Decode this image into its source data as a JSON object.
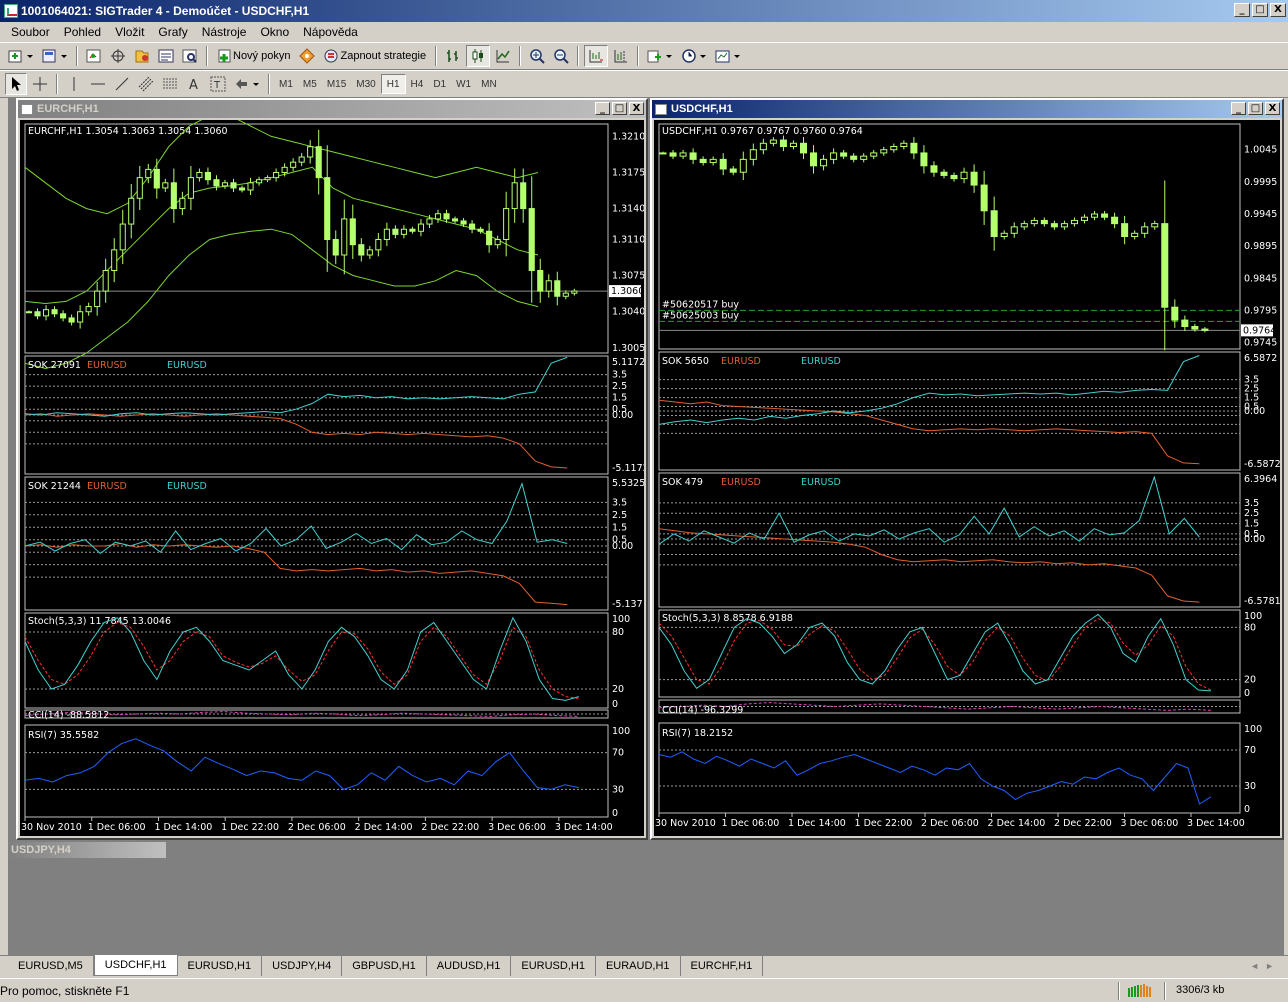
{
  "window": {
    "title": "1001064021: SIGTrader 4 - Demoúčet - USDCHF,H1",
    "btn_min": "_",
    "btn_max": "□",
    "btn_close": "X"
  },
  "menu": [
    "Soubor",
    "Pohled",
    "Vložit",
    "Grafy",
    "Nástroje",
    "Okno",
    "Nápověda"
  ],
  "toolbar": {
    "new_order": "Nový pokyn",
    "strategy": "Zapnout strategie"
  },
  "timeframes": {
    "items": [
      "M1",
      "M5",
      "M15",
      "M30",
      "H1",
      "H4",
      "D1",
      "W1",
      "MN"
    ],
    "active": "H1"
  },
  "colors": {
    "bg": "#000000",
    "frame": "#c0c0c0",
    "candle": "#b4ff6e",
    "bands": "#7cd82e",
    "sok1": "#40d0d0",
    "sok2": "#e06030",
    "stoch_sig": "#ff3030",
    "rsi": "#2060ff",
    "cci": "#e040c0",
    "grid": "#9a9a9a"
  },
  "charts": [
    {
      "title": "EURCHF,H1",
      "main_label": "EURCHF,H1  1.3054 1.3063 1.3054 1.3060",
      "price_axis": [
        "1.3210",
        "1.3175",
        "1.3140",
        "1.3110",
        "1.3075",
        "1.3040",
        "1.3005"
      ],
      "price_range": [
        1.3,
        1.3222
      ],
      "current_price": "1.3060",
      "current_value": 1.306,
      "orders": [],
      "closes": [
        1.304,
        1.3036,
        1.3042,
        1.3038,
        1.3034,
        1.303,
        1.304,
        1.3045,
        1.306,
        1.308,
        1.31,
        1.3125,
        1.315,
        1.317,
        1.3178,
        1.316,
        1.3165,
        1.314,
        1.315,
        1.317,
        1.3175,
        1.3168,
        1.3162,
        1.3165,
        1.316,
        1.3158,
        1.3165,
        1.3168,
        1.317,
        1.3175,
        1.318,
        1.3185,
        1.319,
        1.32,
        1.317,
        1.311,
        1.3095,
        1.313,
        1.3105,
        1.3095,
        1.31,
        1.311,
        1.312,
        1.3115,
        1.312,
        1.3118,
        1.3125,
        1.313,
        1.3135,
        1.313,
        1.3128,
        1.3125,
        1.312,
        1.3118,
        1.3105,
        1.311,
        1.314,
        1.3165,
        1.314,
        1.308,
        1.306,
        1.307,
        1.3055,
        1.3058,
        1.306
      ],
      "bands": {
        "upper": [
          1.318,
          1.3165,
          1.315,
          1.314,
          1.3135,
          1.3145,
          1.317,
          1.32,
          1.322,
          1.323,
          1.323,
          1.322,
          1.321,
          1.3205,
          1.32,
          1.3195,
          1.319,
          1.3185,
          1.318,
          1.3175,
          1.317,
          1.3175,
          1.318,
          1.3175,
          1.317,
          1.3175
        ],
        "mid": [
          1.305,
          1.3048,
          1.305,
          1.306,
          1.308,
          1.31,
          1.312,
          1.314,
          1.3155,
          1.316,
          1.3162,
          1.3165,
          1.317,
          1.3175,
          1.318,
          1.316,
          1.315,
          1.3145,
          1.314,
          1.3135,
          1.313,
          1.3125,
          1.312,
          1.311,
          1.31,
          1.3095
        ],
        "lower": [
          1.299,
          1.2985,
          1.299,
          1.3,
          1.3015,
          1.303,
          1.305,
          1.3075,
          1.3095,
          1.311,
          1.3115,
          1.3118,
          1.312,
          1.3115,
          1.31,
          1.3085,
          1.3075,
          1.307,
          1.3065,
          1.3065,
          1.307,
          1.308,
          1.3075,
          1.306,
          1.305,
          1.3045
        ]
      },
      "sok1": {
        "label": "SOK 27091",
        "name1": "EURUSD",
        "name2": "EURUSD",
        "max": "5.1172",
        "min": "-5.1172",
        "levels": [
          "3.5",
          "2.5",
          "1.5",
          "0.5",
          "0.00"
        ],
        "range": [
          -5.1172,
          5.1172
        ],
        "a": [
          0.1,
          0.0,
          0.2,
          0.1,
          0.0,
          -0.1,
          0.1,
          0.2,
          0.0,
          0.1,
          0.2,
          0.1,
          0.0,
          0.1,
          0.2,
          0.3,
          0.2,
          0.5,
          1.0,
          1.8,
          1.6,
          1.7,
          1.5,
          1.6,
          1.4,
          1.5,
          1.4,
          1.5,
          1.6,
          1.5,
          1.4,
          1.8,
          2.0,
          4.5,
          5.0
        ],
        "b": [
          0.0,
          0.1,
          -0.1,
          0.0,
          0.1,
          0.0,
          -0.1,
          0.0,
          0.1,
          0.0,
          -0.1,
          0.0,
          0.1,
          0.0,
          -0.1,
          -0.2,
          -0.3,
          -0.8,
          -1.5,
          -1.7,
          -1.6,
          -1.7,
          -1.5,
          -1.6,
          -1.7,
          -1.6,
          -1.7,
          -1.8,
          -1.9,
          -1.8,
          -2.0,
          -2.5,
          -4.0,
          -4.5,
          -4.6
        ]
      },
      "sok2": {
        "label": "SOK 21244",
        "name1": "EURUSD",
        "name2": "EURUSD",
        "max": "5.5325",
        "min": "-5.137",
        "levels": [
          "3.5",
          "2.5",
          "1.5",
          "0.5",
          "0.00"
        ],
        "range": [
          -5.137,
          5.5325
        ],
        "a": [
          0.0,
          0.3,
          -0.4,
          0.2,
          0.5,
          -0.6,
          0.3,
          0.0,
          0.4,
          -0.5,
          1.2,
          -0.3,
          0.2,
          0.6,
          -0.4,
          0.2,
          1.4,
          0.0,
          0.5,
          1.6,
          -0.2,
          0.3,
          1.0,
          0.2,
          0.6,
          -0.3,
          0.9,
          0.1,
          0.3,
          1.2,
          0.5,
          0.2,
          2.0,
          5.0,
          0.3,
          0.5,
          0.2
        ],
        "b": [
          0.0,
          0.1,
          -0.1,
          0.1,
          0.0,
          0.0,
          0.2,
          -0.1,
          0.1,
          0.0,
          0.1,
          0.0,
          -0.1,
          0.0,
          -0.2,
          -0.5,
          -1.8,
          -2.0,
          -1.9,
          -2.0,
          -1.9,
          -1.8,
          -2.0,
          -1.9,
          -2.1,
          -2.0,
          -2.2,
          -2.1,
          -2.0,
          -2.2,
          -2.4,
          -3.0,
          -4.5,
          -4.6,
          -4.7
        ]
      },
      "stoch": {
        "label": "Stoch(5,3,3) 11.7845 13.0046",
        "levels": [
          "100",
          "80",
          "20",
          "0"
        ],
        "main": [
          70,
          40,
          20,
          25,
          45,
          70,
          90,
          95,
          80,
          50,
          30,
          60,
          80,
          85,
          70,
          50,
          45,
          40,
          50,
          60,
          35,
          20,
          40,
          70,
          85,
          75,
          55,
          30,
          20,
          40,
          80,
          90,
          70,
          50,
          30,
          20,
          60,
          95,
          70,
          30,
          10,
          8,
          12
        ],
        "signal": [
          75,
          50,
          30,
          25,
          35,
          55,
          80,
          90,
          85,
          65,
          40,
          50,
          70,
          80,
          75,
          55,
          48,
          43,
          47,
          55,
          40,
          28,
          35,
          60,
          80,
          78,
          62,
          38,
          25,
          35,
          70,
          85,
          75,
          55,
          35,
          25,
          50,
          85,
          75,
          40,
          20,
          12,
          10
        ]
      },
      "cci": {
        "label": "CCI(14) -88.5812",
        "values": [
          0.3,
          0.5,
          0.7,
          0.6,
          0.4,
          0.5,
          0.6,
          0.5,
          0.7,
          0.8,
          0.6,
          0.5,
          0.4,
          0.6,
          0.5,
          0.3,
          0.4,
          0.6,
          0.5,
          0.4,
          0.3,
          0.2,
          0.4,
          0.5,
          0.3,
          0.2
        ]
      },
      "rsi": {
        "label": "RSI(7) 35.5582",
        "levels": [
          "100",
          "70",
          "30",
          "0"
        ],
        "values": [
          40,
          42,
          38,
          45,
          48,
          55,
          70,
          80,
          85,
          78,
          72,
          60,
          50,
          65,
          58,
          52,
          45,
          50,
          48,
          42,
          40,
          50,
          45,
          30,
          35,
          48,
          40,
          55,
          45,
          38,
          42,
          35,
          50,
          45,
          60,
          70,
          50,
          32,
          30,
          35,
          32
        ]
      },
      "time_axis": [
        "30 Nov 2010",
        "1 Dec 06:00",
        "1 Dec 14:00",
        "1 Dec 22:00",
        "2 Dec 06:00",
        "2 Dec 14:00",
        "2 Dec 22:00",
        "3 Dec 06:00",
        "3 Dec 14:00"
      ]
    },
    {
      "title": "USDCHF,H1",
      "main_label": "USDCHF,H1  0.9767 0.9767 0.9760 0.9764",
      "price_axis": [
        "1.0045",
        "0.9995",
        "0.9945",
        "0.9895",
        "0.9845",
        "0.9795",
        "0.9745"
      ],
      "price_range": [
        0.9735,
        1.0085
      ],
      "current_price": "0.9764",
      "current_value": 0.9764,
      "orders": [
        {
          "label": "#50620517 buy",
          "value": 0.9795
        },
        {
          "label": "#50625003 buy",
          "value": 0.9778
        }
      ],
      "closes": [
        1.004,
        1.0035,
        1.004,
        1.003,
        1.0025,
        1.003,
        1.0015,
        1.001,
        1.003,
        1.0045,
        1.0055,
        1.006,
        1.005,
        1.0055,
        1.004,
        1.002,
        1.003,
        1.004,
        1.0035,
        1.003,
        1.0035,
        1.004,
        1.0045,
        1.005,
        1.0055,
        1.004,
        1.002,
        1.001,
        1.0005,
        1.0,
        1.001,
        0.999,
        0.995,
        0.991,
        0.9915,
        0.9925,
        0.993,
        0.9935,
        0.993,
        0.9925,
        0.993,
        0.9935,
        0.994,
        0.9945,
        0.994,
        0.993,
        0.991,
        0.9915,
        0.9925,
        0.993,
        0.98,
        0.978,
        0.977,
        0.9766,
        0.9764
      ],
      "bands": null,
      "sok1": {
        "label": "SOK 5650",
        "name1": "EURUSD",
        "name2": "EURUSD",
        "max": "6.5872",
        "min": "-6.5872",
        "levels": [
          "3.5",
          "2.5",
          "1.5",
          "0.5",
          "0.00"
        ],
        "range": [
          -6.5872,
          6.5872
        ],
        "a": [
          -1.5,
          -1.2,
          -1.0,
          -1.3,
          -1.0,
          -0.8,
          -1.0,
          -0.6,
          -0.8,
          -0.5,
          -0.3,
          0.0,
          -0.2,
          0.0,
          0.3,
          0.8,
          1.5,
          2.0,
          1.8,
          1.9,
          1.7,
          1.8,
          1.9,
          2.0,
          1.9,
          2.0,
          1.8,
          2.0,
          2.2,
          2.1,
          2.3,
          2.4,
          2.3,
          5.5,
          6.2
        ],
        "b": [
          1.2,
          1.0,
          0.8,
          1.0,
          0.6,
          0.5,
          0.4,
          0.3,
          0.2,
          0.1,
          0.0,
          -0.1,
          -0.3,
          -0.5,
          -1.0,
          -1.5,
          -2.0,
          -2.2,
          -2.1,
          -2.0,
          -2.1,
          -2.0,
          -2.1,
          -2.2,
          -2.1,
          -2.0,
          -2.1,
          -2.2,
          -2.3,
          -2.4,
          -2.3,
          -2.5,
          -5.0,
          -5.8,
          -5.9
        ]
      },
      "sok2": {
        "label": "SOK 479",
        "name1": "EURUSD",
        "name2": "EURUSD",
        "max": "6.3964",
        "min": "-6.5781",
        "levels": [
          "3.5",
          "2.5",
          "1.5",
          "0.5",
          "0.00"
        ],
        "range": [
          -6.5781,
          6.3964
        ],
        "a": [
          -0.5,
          0.5,
          -0.2,
          0.8,
          0.2,
          -0.4,
          0.6,
          0.0,
          2.5,
          -0.3,
          0.4,
          0.8,
          -0.2,
          0.5,
          0.3,
          0.9,
          0.0,
          0.6,
          1.0,
          -0.3,
          0.4,
          2.2,
          0.5,
          3.0,
          0.2,
          1.2,
          0.3,
          0.8,
          -0.2,
          1.0,
          0.4,
          0.6,
          1.8,
          6.0,
          0.5,
          2.0,
          0.2
        ],
        "b": [
          1.0,
          0.8,
          0.6,
          0.5,
          0.4,
          0.3,
          0.2,
          0.1,
          0.0,
          -0.1,
          -0.2,
          -0.3,
          -0.5,
          -0.8,
          -1.5,
          -2.0,
          -2.2,
          -2.1,
          -2.0,
          -2.2,
          -2.1,
          -2.0,
          -2.2,
          -2.3,
          -2.2,
          -2.4,
          -2.3,
          -2.5,
          -2.4,
          -2.6,
          -2.8,
          -3.5,
          -5.5,
          -6.0,
          -6.1
        ]
      },
      "stoch": {
        "label": "Stoch(5,3,3) 8.8578 6.9188",
        "levels": [
          "100",
          "80",
          "20",
          "0"
        ],
        "main": [
          80,
          60,
          30,
          10,
          20,
          50,
          80,
          90,
          85,
          70,
          50,
          60,
          80,
          85,
          70,
          40,
          20,
          15,
          30,
          55,
          75,
          80,
          50,
          20,
          25,
          50,
          75,
          85,
          60,
          30,
          15,
          20,
          45,
          70,
          85,
          95,
          80,
          50,
          40,
          70,
          90,
          60,
          20,
          8,
          7
        ],
        "signal": [
          85,
          70,
          45,
          20,
          15,
          35,
          65,
          85,
          88,
          78,
          60,
          58,
          72,
          82,
          76,
          55,
          32,
          20,
          25,
          45,
          68,
          78,
          60,
          35,
          25,
          40,
          65,
          80,
          70,
          45,
          25,
          18,
          35,
          60,
          80,
          90,
          85,
          62,
          48,
          60,
          82,
          70,
          35,
          15,
          8
        ]
      },
      "cci": {
        "label": "CCI(14) -96.3299",
        "values": [
          0.4,
          0.5,
          0.6,
          0.5,
          0.7,
          0.8,
          0.7,
          0.6,
          0.5,
          0.6,
          0.7,
          0.6,
          0.5,
          0.4,
          0.3,
          0.4,
          0.5,
          0.4,
          0.3,
          0.4,
          0.5,
          0.4,
          0.3,
          0.2,
          0.3,
          0.2
        ]
      },
      "rsi": {
        "label": "RSI(7) 18.2152",
        "levels": [
          "100",
          "70",
          "30",
          "0"
        ],
        "values": [
          65,
          62,
          68,
          60,
          55,
          63,
          58,
          52,
          60,
          55,
          50,
          58,
          42,
          48,
          55,
          58,
          62,
          65,
          60,
          55,
          50,
          45,
          52,
          48,
          42,
          50,
          48,
          55,
          38,
          30,
          25,
          15,
          22,
          25,
          30,
          35,
          32,
          40,
          38,
          45,
          50,
          42,
          38,
          25,
          40,
          55,
          50,
          10,
          18
        ]
      },
      "time_axis": [
        "30 Nov 2010",
        "1 Dec 06:00",
        "1 Dec 14:00",
        "1 Dec 22:00",
        "2 Dec 06:00",
        "2 Dec 14:00",
        "2 Dec 22:00",
        "3 Dec 06:00",
        "3 Dec 14:00"
      ]
    }
  ],
  "minimized_window": {
    "title": "USDJPY,H4"
  },
  "tabs": {
    "items": [
      "EURUSD,M5",
      "USDCHF,H1",
      "EURUSD,H1",
      "USDJPY,H4",
      "GBPUSD,H1",
      "AUDUSD,H1",
      "EURUSD,H1",
      "EURAUD,H1",
      "EURCHF,H1"
    ],
    "active": "USDCHF,H1"
  },
  "status": {
    "help": "Pro pomoc, stiskněte F1",
    "size": "3306/3 kb"
  }
}
